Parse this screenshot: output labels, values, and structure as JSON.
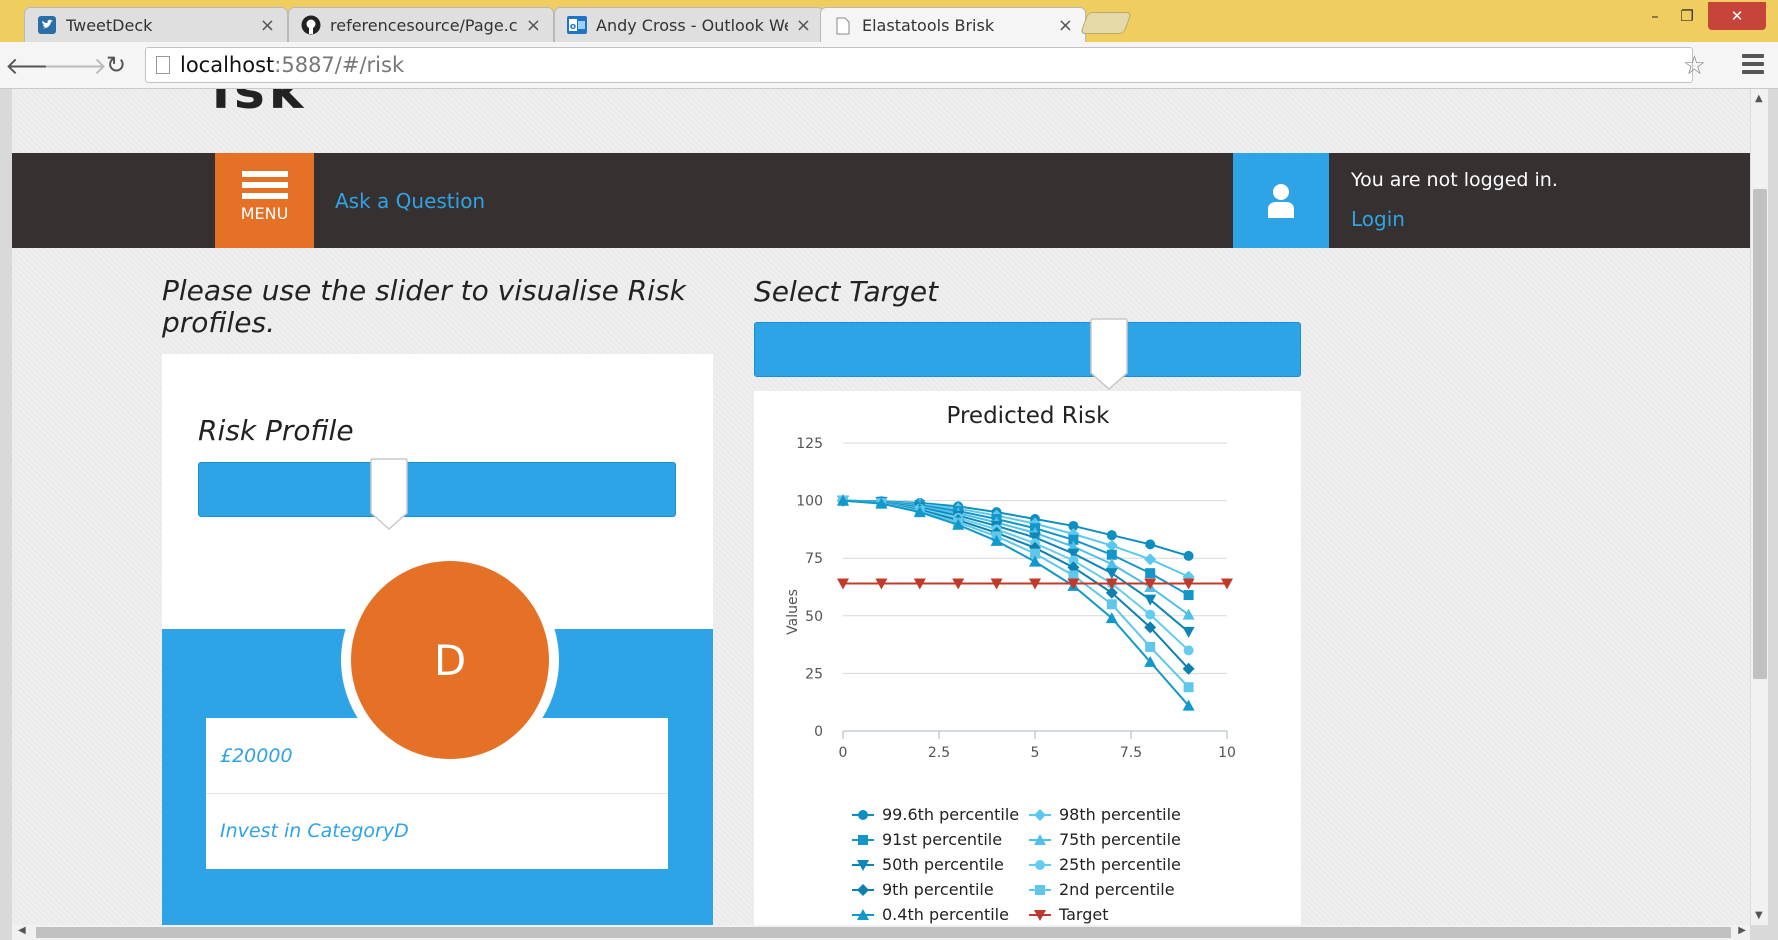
{
  "browser": {
    "tabs": [
      {
        "title": "TweetDeck",
        "icon": "tweetdeck-icon"
      },
      {
        "title": "referencesource/Page.cs a",
        "icon": "github-icon"
      },
      {
        "title": "Andy Cross - Outlook Wel",
        "icon": "outlook-icon"
      },
      {
        "title": "Elastatools Brisk",
        "icon": "page-icon",
        "active": true
      }
    ],
    "url_host": "localhost",
    "url_path": ":5887/#/risk",
    "close_glyph": "×"
  },
  "header": {
    "logo_remnant": "isk",
    "menu_label": "MENU",
    "ask_link": "Ask a Question",
    "login_status": "You are not logged in.",
    "login_link": "Login"
  },
  "left_panel": {
    "instruction": "Please use the slider to visualise Risk profiles.",
    "card_title": "Risk Profile",
    "slider_value": 0.4,
    "category_letter": "D",
    "amount": "£20000",
    "recommendation": "Invest in CategoryD"
  },
  "right_panel": {
    "title": "Select Target",
    "slider_value": 0.65
  },
  "colors": {
    "accent_blue": "#2ea3e6",
    "accent_orange": "#e57126",
    "nav_dark": "#363130",
    "target_red": "#c0392b"
  },
  "chart_data": {
    "type": "line",
    "title": "Predicted Risk",
    "xlabel": "",
    "ylabel": "Values",
    "xlim": [
      0,
      10
    ],
    "ylim": [
      0,
      125
    ],
    "x_ticks": [
      0,
      2.5,
      5,
      7.5,
      10
    ],
    "y_ticks": [
      0,
      25,
      50,
      75,
      100,
      125
    ],
    "x_tick_labels": [
      "0",
      "2.5",
      "5",
      "7.5",
      "10"
    ],
    "y_tick_labels": [
      "0",
      "25",
      "50",
      "75",
      "100",
      "125"
    ],
    "grid": true,
    "legend_position": "bottom",
    "series": [
      {
        "name": "99.6th percentile",
        "color": "#0f8fc0",
        "marker": "circle",
        "x": [
          0,
          1,
          2,
          3,
          4,
          5,
          6,
          7,
          8,
          9
        ],
        "y": [
          100,
          99.7,
          99,
          97.5,
          95,
          92,
          89,
          85,
          81,
          76
        ]
      },
      {
        "name": "98th percentile",
        "color": "#5ac8ef",
        "marker": "diamond",
        "x": [
          0,
          1,
          2,
          3,
          4,
          5,
          6,
          7,
          8,
          9
        ],
        "y": [
          100,
          99.6,
          98.5,
          96.5,
          93.5,
          90,
          85.5,
          80.5,
          74.5,
          67
        ]
      },
      {
        "name": "91st percentile",
        "color": "#1596c9",
        "marker": "square",
        "x": [
          0,
          1,
          2,
          3,
          4,
          5,
          6,
          7,
          8,
          9
        ],
        "y": [
          100,
          99.5,
          98,
          95.5,
          92,
          88,
          83,
          76.5,
          68.5,
          59
        ]
      },
      {
        "name": "75th percentile",
        "color": "#4fc0ea",
        "marker": "triangle",
        "x": [
          0,
          1,
          2,
          3,
          4,
          5,
          6,
          7,
          8,
          9
        ],
        "y": [
          100,
          99.4,
          97.5,
          94.5,
          90.5,
          86,
          80,
          72.5,
          62.5,
          50.5
        ]
      },
      {
        "name": "50th percentile",
        "color": "#0e87b8",
        "marker": "triangle-down",
        "x": [
          0,
          1,
          2,
          3,
          4,
          5,
          6,
          7,
          8,
          9
        ],
        "y": [
          100,
          99.3,
          97,
          93.5,
          89,
          84,
          77,
          68.5,
          57,
          43
        ]
      },
      {
        "name": "25th percentile",
        "color": "#63cdef",
        "marker": "circle",
        "x": [
          0,
          1,
          2,
          3,
          4,
          5,
          6,
          7,
          8,
          9
        ],
        "y": [
          100,
          99.1,
          96.5,
          92.5,
          87.5,
          81.5,
          74,
          64,
          50.5,
          35
        ]
      },
      {
        "name": "9th percentile",
        "color": "#0d80b0",
        "marker": "diamond",
        "x": [
          0,
          1,
          2,
          3,
          4,
          5,
          6,
          7,
          8,
          9
        ],
        "y": [
          100,
          99,
          96,
          91.5,
          86,
          79.5,
          71,
          60,
          45,
          27
        ]
      },
      {
        "name": "2nd percentile",
        "color": "#5fc6ec",
        "marker": "square",
        "x": [
          0,
          1,
          2,
          3,
          4,
          5,
          6,
          7,
          8,
          9
        ],
        "y": [
          100,
          98.9,
          95.5,
          90.5,
          84.5,
          77,
          67.5,
          55,
          36.5,
          19
        ]
      },
      {
        "name": "0.4th percentile",
        "color": "#1199cc",
        "marker": "triangle",
        "x": [
          0,
          1,
          2,
          3,
          4,
          5,
          6,
          7,
          8,
          9
        ],
        "y": [
          100,
          98.7,
          95,
          89.5,
          82.5,
          73.5,
          63,
          49,
          30,
          11
        ]
      },
      {
        "name": "Target",
        "color": "#c0392b",
        "marker": "triangle-down",
        "x": [
          0,
          1,
          2,
          3,
          4,
          5,
          6,
          7,
          8,
          9,
          10
        ],
        "y": [
          64,
          64,
          64,
          64,
          64,
          64,
          64,
          64,
          64,
          64,
          64
        ]
      }
    ]
  }
}
